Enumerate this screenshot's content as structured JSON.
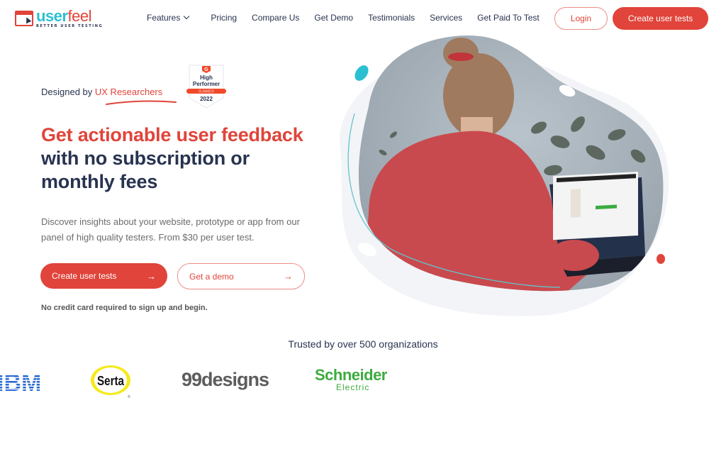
{
  "brand": {
    "name_part1": "user",
    "name_part2": "feel",
    "tagline": "BETTER USER TESTING",
    "colors": {
      "primary": "#e0443a",
      "secondary": "#2bbfd2",
      "text": "#283350"
    }
  },
  "nav": {
    "items": [
      {
        "label": "Features",
        "has_dropdown": true
      },
      {
        "label": "Pricing"
      },
      {
        "label": "Compare Us"
      },
      {
        "label": "Get Demo"
      },
      {
        "label": "Testimonials"
      },
      {
        "label": "Services"
      },
      {
        "label": "Get Paid To Test"
      }
    ],
    "login_label": "Login",
    "cta_label": "Create user tests"
  },
  "hero": {
    "designed_prefix": "Designed by ",
    "designed_accent": "UX Researchers",
    "badge": {
      "brand": "G",
      "line1": "High",
      "line2": "Performer",
      "season": "SUMMER",
      "year": "2022"
    },
    "headline_red": "Get actionable user feedback",
    "headline_line2": "with no subscription or",
    "headline_line3": "monthly fees",
    "subtext": "Discover insights about your website, prototype or app from our panel of high quality testers. From $30 per user test.",
    "primary_button": "Create user tests",
    "secondary_button": "Get a demo",
    "arrow_icon": "→",
    "note": "No credit card required to sign up and begin."
  },
  "trusted": {
    "title": "Trusted by over 500 organizations",
    "logos": [
      {
        "name": "IBM",
        "text": "IBM"
      },
      {
        "name": "Serta",
        "text": "Serta"
      },
      {
        "name": "99designs",
        "text": "99designs"
      },
      {
        "name": "Schneider Electric",
        "text_top": "Schneider",
        "text_bottom": "Electric"
      }
    ]
  }
}
